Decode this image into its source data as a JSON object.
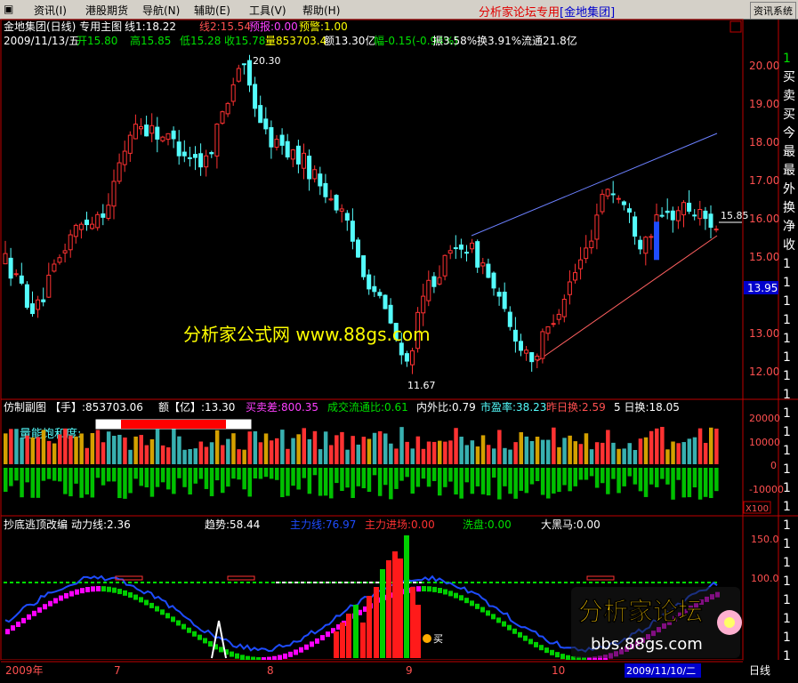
{
  "menu": {
    "items": [
      "资讯(I)",
      "港股期货",
      "导航(N)",
      "辅助(E)",
      "工具(V)",
      "帮助(H)"
    ],
    "brand_red": "分析家论坛专用",
    "brand_blue": "[金地集团]",
    "sys_button": "资讯系统"
  },
  "main_chart": {
    "title": "金地集团(日线) 专用主图",
    "ind1": "线1:18.22",
    "ind2": "线2:15.54",
    "ind3": "预报:0.00",
    "ind4": "预警:1.00",
    "date": "2009/11/13/五",
    "open": "开15.80",
    "high": "高15.85",
    "low": "低15.28",
    "close": "收15.78",
    "volume": "量853703.4",
    "amount": "额13.30亿",
    "change": "幅-0.15(-0.94%)",
    "amplitude": "振3.58%",
    "turnover": "换3.91%",
    "float": "流通21.8亿",
    "high_label": "20.30",
    "low_label": "11.67",
    "last_label": "15.85",
    "current_price": "13.95",
    "watermark": "分析家公式网 www.88gs.com",
    "y_ticks": [
      "20.00",
      "19.00",
      "18.00",
      "17.00",
      "16.00",
      "15.00",
      "14.00",
      "13.00",
      "12.00"
    ]
  },
  "sub_chart": {
    "title": "仿制副图",
    "hand": "【手】:853703.06",
    "amount": "额【亿】:13.30",
    "buysell": "买卖差:800.35",
    "ratio": "成交流通比:0.61",
    "inout": "内外比:0.79",
    "pe": "市盈率:38.23",
    "prev_turn": "昨日换:2.59",
    "five_day": "5 日换:18.05",
    "energy_label": "量能饱和度:",
    "y_ticks": [
      "20000",
      "10000",
      "0",
      "-10000"
    ],
    "unit": "X100"
  },
  "third_chart": {
    "title": "抄底逃顶改编",
    "power": "动力线:2.36",
    "trend": "趋势:58.44",
    "main": "主力线:76.97",
    "main_in": "主力进场:0.00",
    "wash": "洗盘:0.00",
    "horse": "大黑马:0.00",
    "buy_label": "买",
    "y_ticks": [
      "150.0",
      "100.0"
    ],
    "watermark_title": "分析家论坛",
    "watermark_url": "bbs.88gs.com"
  },
  "xaxis": {
    "labels": [
      "2009年",
      "7",
      "8",
      "9",
      "10"
    ],
    "date_box": "2009/11/10/二",
    "period": "日线"
  },
  "right_panel": {
    "chars": [
      "1",
      "买",
      "卖",
      "买",
      "今",
      "最",
      "最",
      "外",
      "换",
      "净",
      "收",
      "1",
      "1",
      "1",
      "1",
      "1",
      "1",
      "1",
      "1",
      "1",
      "1",
      "1",
      "1",
      "1",
      "1",
      "1",
      "1",
      "1",
      "1",
      "1",
      "1",
      "1",
      "1"
    ]
  },
  "colors": {
    "up": "#ff3232",
    "down": "#54fcfc",
    "green": "#00d000",
    "yellow": "#ffff00",
    "magenta": "#ff00ff",
    "blue_line": "#1e4cff",
    "bg": "#000000"
  },
  "candles": [
    {
      "o": 14.9,
      "h": 15.3,
      "l": 14.5,
      "c": 15.1
    }
  ]
}
